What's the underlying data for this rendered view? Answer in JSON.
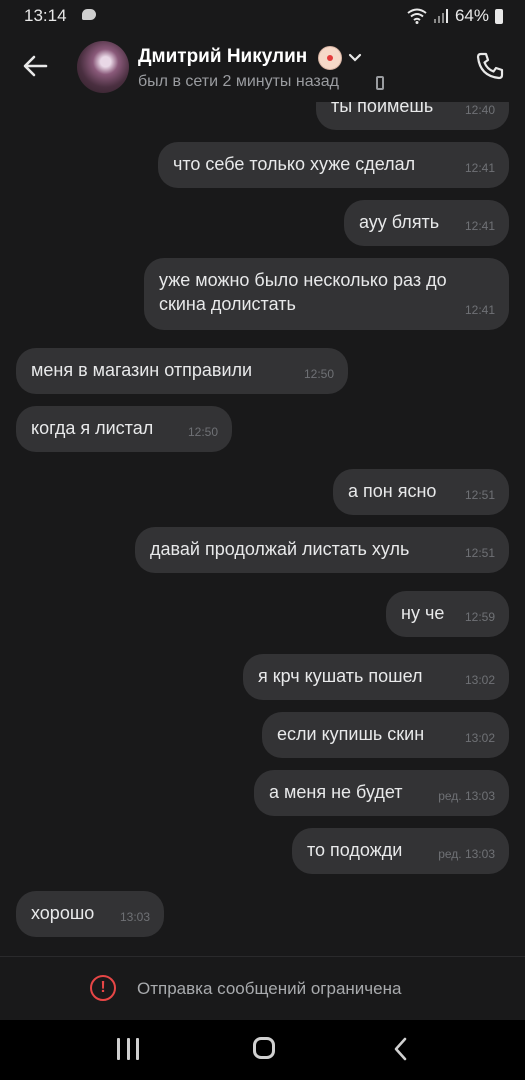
{
  "status_bar": {
    "time": "13:14",
    "battery": "64%"
  },
  "header": {
    "name": "Дмитрий Никулин",
    "status": "был в сети 2 минуты назад"
  },
  "messages": [
    {
      "text": "ты поймешь",
      "time": "12:40",
      "side": "out"
    },
    {
      "text": "что себе только хуже сделал",
      "time": "12:41",
      "side": "out"
    },
    {
      "text": "ауу блять",
      "time": "12:41",
      "side": "out"
    },
    {
      "text": "уже можно было несколько раз до скина долистать",
      "time": "12:41",
      "side": "out"
    },
    {
      "text": "меня в магазин отправили",
      "time": "12:50",
      "side": "in"
    },
    {
      "text": "когда я листал",
      "time": "12:50",
      "side": "in"
    },
    {
      "text": "а пон ясно",
      "time": "12:51",
      "side": "out"
    },
    {
      "text": "давай продолжай листать хуль",
      "time": "12:51",
      "side": "out"
    },
    {
      "text": "ну че",
      "time": "12:59",
      "side": "out"
    },
    {
      "text": "я крч кушать пошел",
      "time": "13:02",
      "side": "out"
    },
    {
      "text": "если купишь скин",
      "time": "13:02",
      "side": "out"
    },
    {
      "text": "а меня не будет",
      "time": "ред. 13:03",
      "side": "out"
    },
    {
      "text": "то подожди",
      "time": "ред. 13:03",
      "side": "out"
    },
    {
      "text": "хорошо",
      "time": "13:03",
      "side": "in"
    }
  ],
  "footer": {
    "notice": "Отправка сообщений ограничена"
  },
  "colors": {
    "background": "#19191a",
    "bubble": "#333335",
    "warning": "#e64646"
  },
  "icons": [
    "back-arrow-icon",
    "clown-emoji-icon",
    "chevron-down-icon",
    "mobile-device-icon",
    "phone-call-icon",
    "warning-icon",
    "nav-recent-icon",
    "nav-home-icon",
    "nav-back-icon",
    "wifi-icon",
    "signal-icon",
    "battery-icon",
    "message-notification-icon"
  ]
}
